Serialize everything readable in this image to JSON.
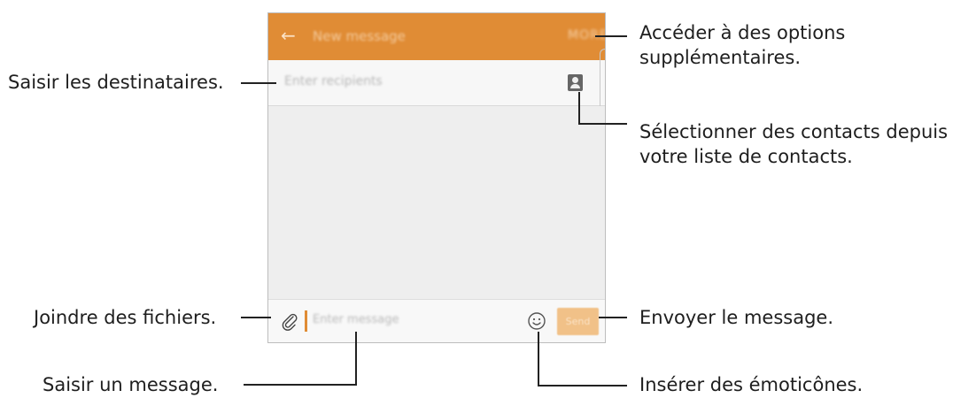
{
  "app": {
    "title": "New message",
    "accent_color": "#e08c35"
  },
  "recipients": {
    "placeholder": "Enter recipients",
    "contact_button_icon": "contact-card-icon"
  },
  "compose": {
    "attach_icon": "paperclip-icon",
    "placeholder": "Enter message",
    "emoji_icon": "smiley-icon",
    "send_label": "Send"
  },
  "callouts": {
    "more_options_line1": "Accéder à des options",
    "more_options_line2": "supplémentaires.",
    "recipients": "Saisir les destinataires.",
    "contacts_line1": "Sélectionner des contacts depuis",
    "contacts_line2": "votre liste de contacts.",
    "attach": "Joindre des fichiers.",
    "send": "Envoyer le message.",
    "message": "Saisir un message.",
    "emoticons": "Insérer des émoticônes."
  }
}
